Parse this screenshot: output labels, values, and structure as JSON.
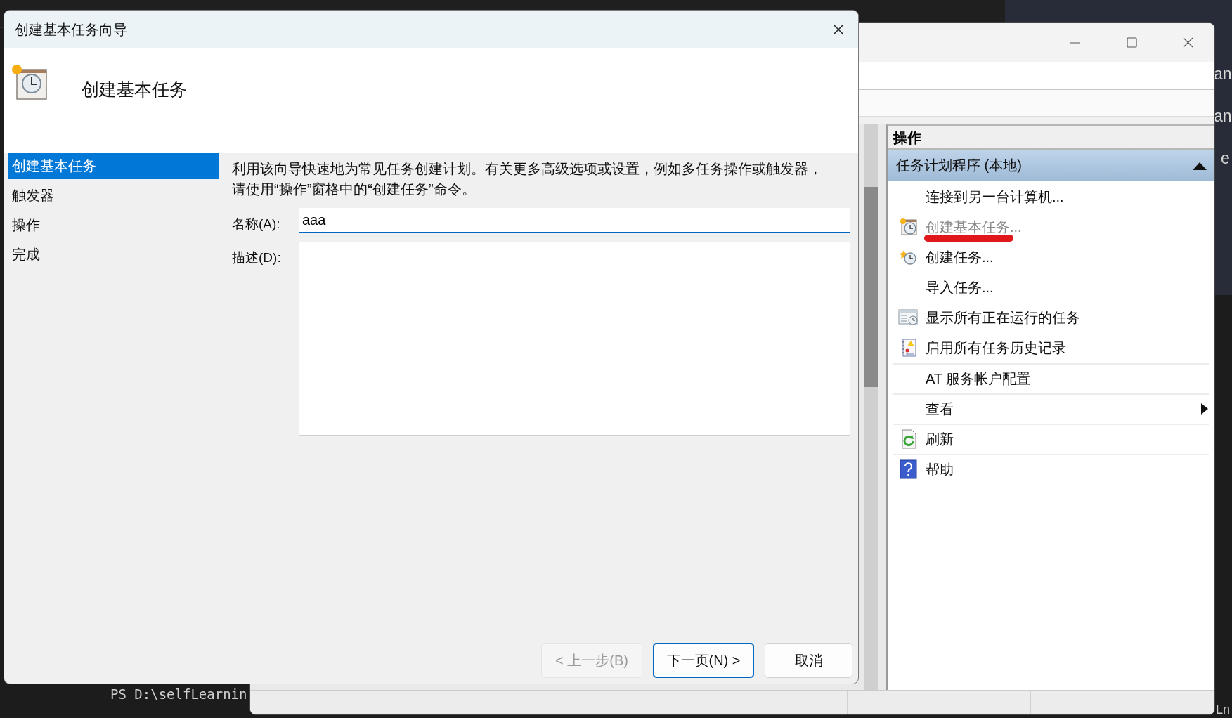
{
  "background": {
    "terminal_line": "PS D:\\selfLearnin",
    "edge_texts": [
      "an",
      "an",
      "e"
    ],
    "corner_text": "Ln"
  },
  "scheduler": {
    "actions_pane": {
      "title": "操作",
      "group": {
        "label": "任务计划程序 (本地)",
        "expanded": true
      },
      "items": [
        {
          "label": "连接到另一台计算机...",
          "kind": "plain",
          "disabled": false,
          "submenu": false,
          "separator_before": false,
          "marked": false
        },
        {
          "label": "创建基本任务...",
          "kind": "task-clock",
          "disabled": true,
          "submenu": false,
          "separator_before": false,
          "marked": true
        },
        {
          "label": "创建任务...",
          "kind": "clock-star",
          "disabled": false,
          "submenu": false,
          "separator_before": false,
          "marked": false
        },
        {
          "label": "导入任务...",
          "kind": "plain",
          "disabled": false,
          "submenu": false,
          "separator_before": false,
          "marked": false
        },
        {
          "label": "显示所有正在运行的任务",
          "kind": "window-list",
          "disabled": false,
          "submenu": false,
          "separator_before": false,
          "marked": false
        },
        {
          "label": "启用所有任务历史记录",
          "kind": "notebook",
          "disabled": false,
          "submenu": false,
          "separator_before": false,
          "marked": false
        },
        {
          "label": "AT 服务帐户配置",
          "kind": "plain",
          "disabled": false,
          "submenu": false,
          "separator_before": true,
          "marked": false
        },
        {
          "label": "查看",
          "kind": "plain",
          "disabled": false,
          "submenu": true,
          "separator_before": true,
          "marked": false
        },
        {
          "label": "刷新",
          "kind": "refresh",
          "disabled": false,
          "submenu": false,
          "separator_before": true,
          "marked": false
        },
        {
          "label": "帮助",
          "kind": "help",
          "disabled": false,
          "submenu": false,
          "separator_before": true,
          "marked": false
        }
      ]
    }
  },
  "dialog": {
    "title": "创建基本任务向导",
    "heading": "创建基本任务",
    "steps": [
      {
        "label": "创建基本任务",
        "selected": true
      },
      {
        "label": "触发器",
        "selected": false
      },
      {
        "label": "操作",
        "selected": false
      },
      {
        "label": "完成",
        "selected": false
      }
    ],
    "intro": "利用该向导快速地为常见任务创建计划。有关更多高级选项或设置，例如多任务操作或触发器，请使用“操作”窗格中的“创建任务”命令。",
    "name_field": {
      "label": "名称(A):",
      "value": "aaa",
      "focused": true
    },
    "description_field": {
      "label": "描述(D):"
    },
    "buttons": [
      {
        "label": "< 上一步(B)",
        "disabled": true,
        "default": false
      },
      {
        "label": "下一页(N) >",
        "disabled": false,
        "default": true
      },
      {
        "label": "取消",
        "disabled": false,
        "default": false
      }
    ]
  }
}
